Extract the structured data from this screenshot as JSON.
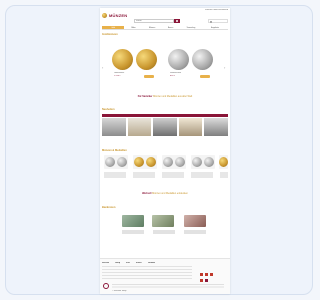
{
  "brand": {
    "logo_text": "MÜNZEN",
    "accent": "#8a1538",
    "gold": "#c9962e"
  },
  "topbar": {
    "links": [
      "Kontakt",
      "Konto",
      "Warenkorb"
    ]
  },
  "search": {
    "placeholder": "Suche",
    "button_label": "Los"
  },
  "nav": {
    "tabs": [
      "Gold",
      "Silber",
      "Münzen",
      "Barren",
      "Sammlung",
      "Angebote"
    ]
  },
  "hero": {
    "title": "Goldmünzen",
    "items": [
      {
        "label": "Goldmünze",
        "price": "1.250 €"
      },
      {
        "label": "Silbermünze",
        "price": "890 €"
      }
    ]
  },
  "headline1": {
    "prefix": "Für Sammler",
    "text": "Münzen und Medaillen aus aller Welt"
  },
  "section2": {
    "title": "Neuheiten"
  },
  "section3": {
    "title": "Münzen & Medaillen"
  },
  "headline2": {
    "prefix": "Wertvoll",
    "text": "Münzen und Medaillen entdecken"
  },
  "section4": {
    "title": "Banknoten"
  },
  "footer": {
    "columns": [
      "Service",
      "Shop",
      "Info",
      "Konto",
      "Kontakt"
    ],
    "copyright": "© Münzen Shop"
  },
  "icons": [
    "search-icon",
    "cart-icon",
    "user-icon",
    "chevron-left-icon",
    "chevron-right-icon",
    "social-icon"
  ]
}
